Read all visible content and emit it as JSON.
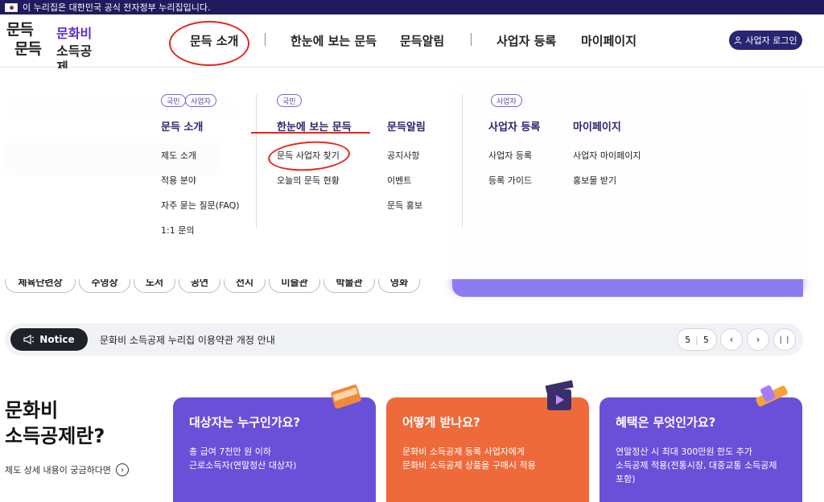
{
  "gov_banner": "이 누리집은 대한민국 공식 전자정부 누리집입니다.",
  "logo": {
    "line1": "문득",
    "line2": "문득",
    "line3": "문화비",
    "line4": "소득공제"
  },
  "nav": {
    "items": [
      "문득 소개",
      "한눈에 보는 문득",
      "문득알림",
      "사업자 등록",
      "마이페이지"
    ],
    "login": "사업자 로그인"
  },
  "mega_menu": {
    "tags": {
      "citizen": "국민",
      "business": "사업자"
    },
    "columns": [
      {
        "title": "문득 소개",
        "items": [
          "제도 소개",
          "적용 분야",
          "자주 묻는 질문(FAQ)",
          "1:1 문의"
        ]
      },
      {
        "title": "한눈에 보는 문득",
        "items": [
          "문득 사업자 찾기",
          "오늘의 문득 현황"
        ]
      },
      {
        "title": "문득알림",
        "items": [
          "공지사항",
          "이벤트",
          "문득 홍보"
        ]
      },
      {
        "title": "사업자 등록",
        "items": [
          "사업자 등록",
          "등록 가이드"
        ]
      },
      {
        "title": "마이페이지",
        "items": [
          "사업자 마이페이지",
          "홍보물 받기"
        ]
      }
    ]
  },
  "keyword_chips": [
    "체육단련장",
    "수영장",
    "도서",
    "공연",
    "전시",
    "미술관",
    "박물관",
    "영화"
  ],
  "notice": {
    "badge": "Notice",
    "text": "문화비 소득공제 누리집 이용약관 개정 안내",
    "current": "5",
    "total": "5"
  },
  "intro": {
    "title_line1": "문화비",
    "title_line2": "소득공제란?",
    "more": "제도 상세 내용이 궁금하다면"
  },
  "cards": [
    {
      "title": "대상자는 누구인가요?",
      "desc1": "총 급여 7천만 원 이하",
      "desc2": "근로소득자(연말정산 대상자)",
      "desc3": "",
      "color": "#6a4fd9",
      "icon": "book-icon"
    },
    {
      "title": "어떻게 받나요?",
      "desc1": "문화비 소득공제 등록 사업자에게",
      "desc2": "문화비 소득공제 상품을 구매시 적용",
      "desc3": "",
      "color": "#ef6a3a",
      "icon": "clapperboard-icon"
    },
    {
      "title": "혜택은 무엇인가요?",
      "desc1": "연말정산 시 최대 300만원 한도 추가",
      "desc2": "소득공제 적용(전통시장, 대중교통 소득공제",
      "desc3": "포함)",
      "color": "#6a4fd9",
      "icon": "dumbbell-icon"
    }
  ]
}
